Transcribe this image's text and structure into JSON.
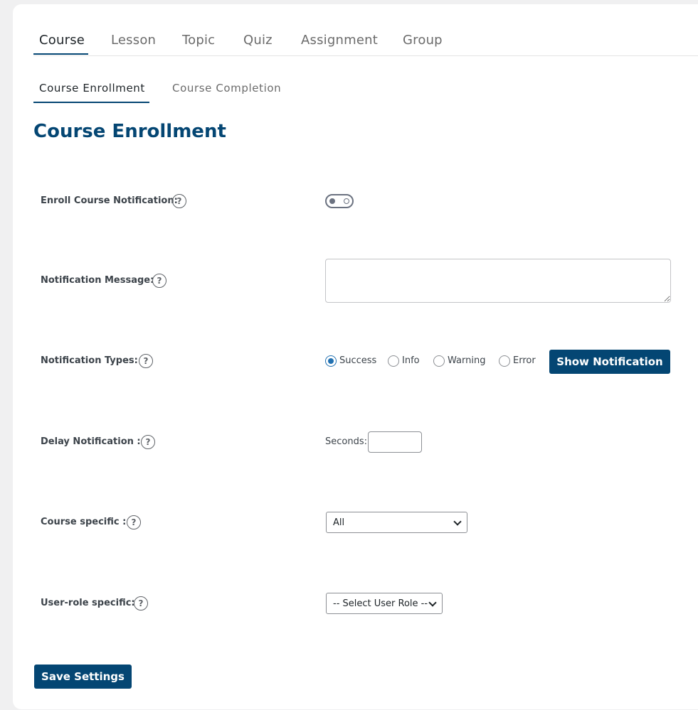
{
  "main_tabs": [
    {
      "label": "Course",
      "active": true
    },
    {
      "label": "Lesson",
      "active": false
    },
    {
      "label": "Topic",
      "active": false
    },
    {
      "label": "Quiz",
      "active": false
    },
    {
      "label": "Assignment",
      "active": false
    },
    {
      "label": "Group",
      "active": false
    }
  ],
  "sub_tabs": [
    {
      "label": "Course Enrollment",
      "active": true
    },
    {
      "label": "Course Completion",
      "active": false
    }
  ],
  "page_title": "Course Enrollment",
  "help_icon": {
    "glyph": "?",
    "icon": "question-circle-icon"
  },
  "fields": {
    "enroll_notification": {
      "label": "Enroll Course Notification:",
      "enabled": false
    },
    "notification_message": {
      "label": "Notification Message:",
      "value": ""
    },
    "notification_types": {
      "label": "Notification Types:",
      "options": [
        "Success",
        "Info",
        "Warning",
        "Error"
      ],
      "selected": "Success",
      "button_label": "Show Notification"
    },
    "delay_notification": {
      "label": "Delay Notification :",
      "unit_label": "Seconds:",
      "value": ""
    },
    "course_specific": {
      "label": "Course specific :",
      "selected": "All"
    },
    "user_role_specific": {
      "label": "User-role specific:",
      "selected": "-- Select User Role --"
    }
  },
  "save_button_label": "Save Settings",
  "colors": {
    "accent": "#044673",
    "radio_checked": "#2271b1",
    "background": "#f0f0f1"
  }
}
